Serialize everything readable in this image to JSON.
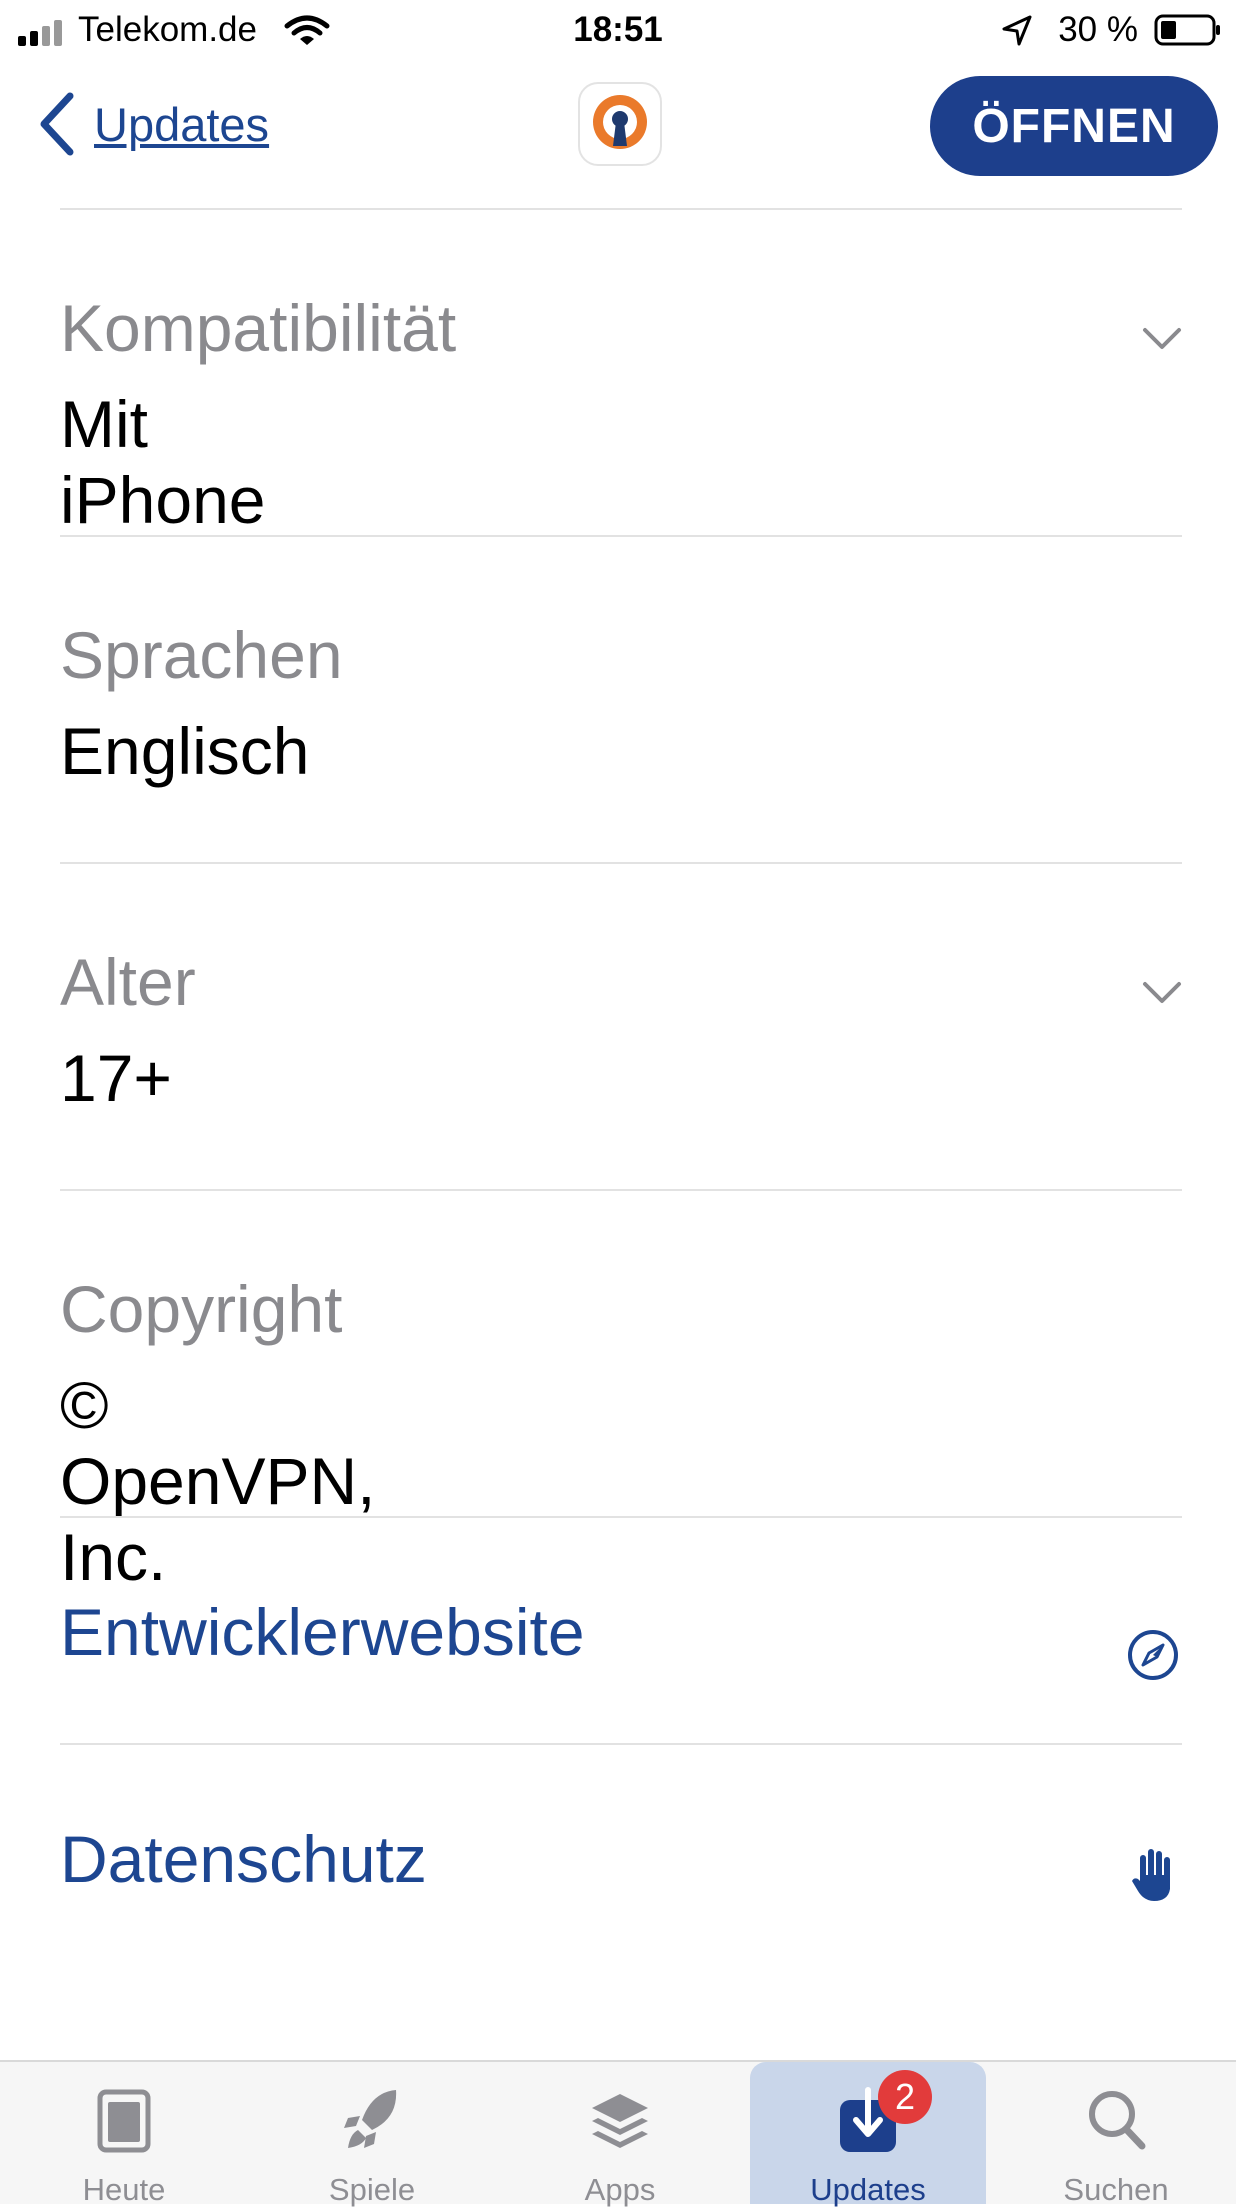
{
  "status_bar": {
    "carrier": "Telekom.de",
    "time": "18:51",
    "battery_percent": "30 %"
  },
  "nav": {
    "back_label": "Updates",
    "open_label": "ÖFFNEN",
    "app_icon": "openvpn-keyhole-icon"
  },
  "info_rows": [
    {
      "label": "Kompatibilität",
      "value": "Mit iPhone",
      "expandable": true
    },
    {
      "label": "Sprachen",
      "value": "Englisch",
      "expandable": false
    },
    {
      "label": "Alter",
      "value": "17+",
      "expandable": true
    },
    {
      "label": "Copyright",
      "value": "© OpenVPN, Inc.",
      "expandable": false
    }
  ],
  "links": [
    {
      "label": "Entwicklerwebsite",
      "icon": "compass-icon"
    },
    {
      "label": "Datenschutz",
      "icon": "hand-icon"
    }
  ],
  "tabs": [
    {
      "label": "Heute",
      "icon": "today-icon",
      "active": false
    },
    {
      "label": "Spiele",
      "icon": "rocket-icon",
      "active": false
    },
    {
      "label": "Apps",
      "icon": "layers-icon",
      "active": false
    },
    {
      "label": "Updates",
      "icon": "download-icon",
      "active": true,
      "badge": "2"
    },
    {
      "label": "Suchen",
      "icon": "search-icon",
      "active": false
    }
  ],
  "colors": {
    "accent": "#1d4691",
    "button_bg": "#1d3f8c",
    "label_gray": "#8a8a8e",
    "badge_red": "#e23b3b",
    "openvpn_orange": "#ea7a2b"
  }
}
